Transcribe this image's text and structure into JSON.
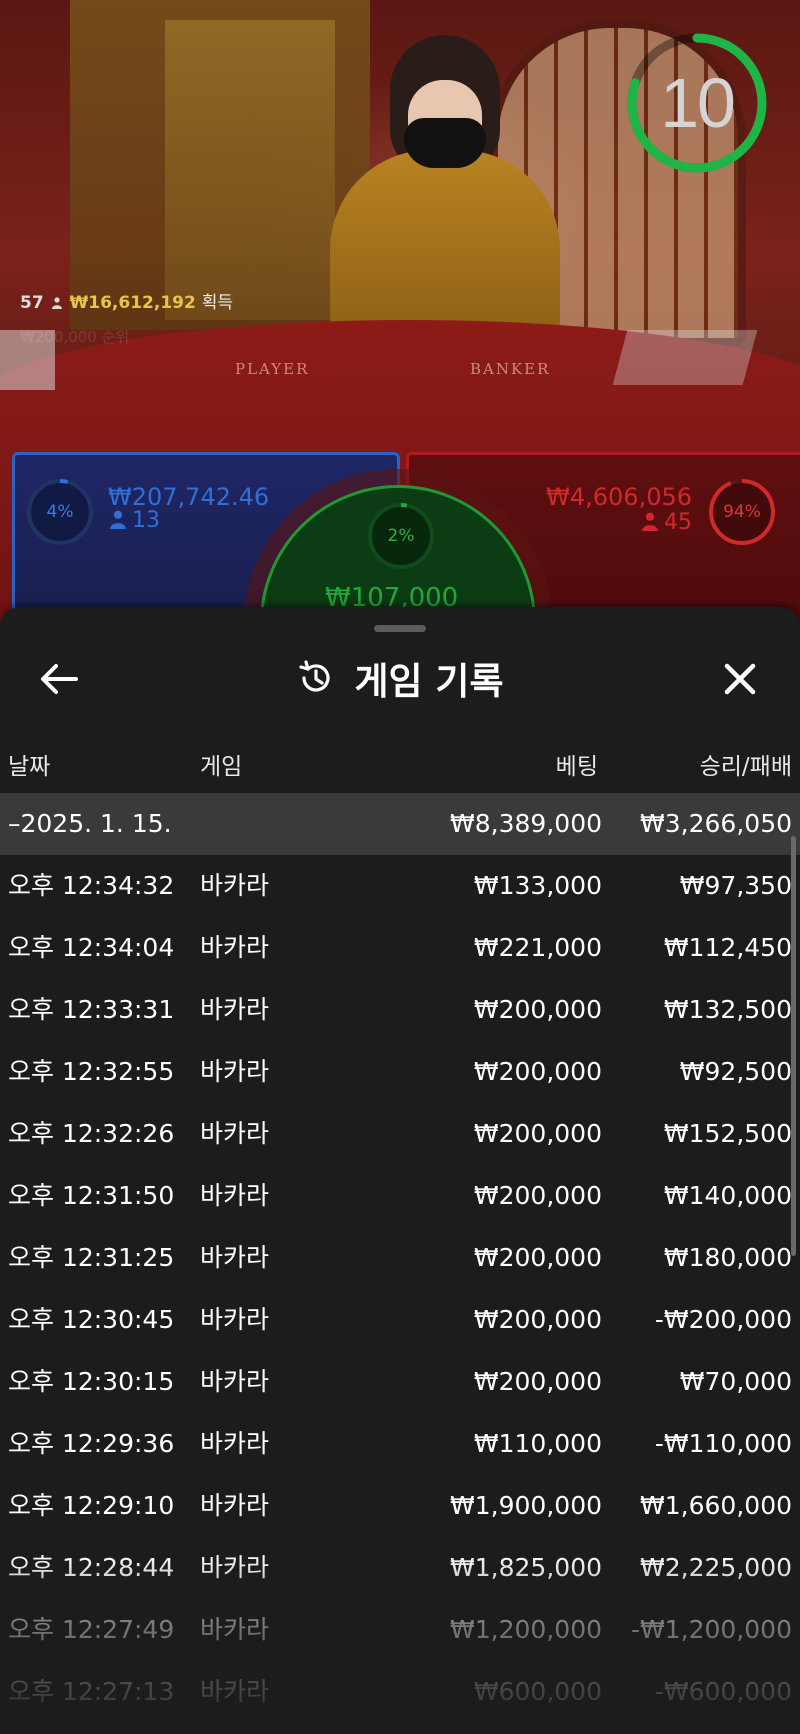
{
  "timer": {
    "value": "10",
    "progress": 0.8,
    "color": "#1fb546"
  },
  "streamer_stats": {
    "count": "57",
    "amount": "₩16,612,192",
    "label": "획득",
    "faded_line": "₩200,000  순위"
  },
  "table_labels": {
    "player": "PLAYER",
    "banker": "BANKER"
  },
  "bets": {
    "player": {
      "percent": "4%",
      "percent_value": 0.04,
      "amount": "₩207,742.46",
      "count": "13",
      "color": "#2f6fd6"
    },
    "banker": {
      "percent": "94%",
      "percent_value": 0.94,
      "amount": "₩4,606,056",
      "count": "45",
      "color": "#d0292a"
    },
    "tie": {
      "percent": "2%",
      "percent_value": 0.02,
      "amount": "₩107,000",
      "color": "#22a83a"
    }
  },
  "history": {
    "title": "게임 기록",
    "columns": {
      "date": "날짜",
      "game": "게임",
      "bet": "베팅",
      "result": "승리/패배"
    },
    "date_group": {
      "label": "–2025. 1. 15.",
      "total_bet": "₩8,389,000",
      "total_result": "₩3,266,050"
    },
    "rows": [
      {
        "time": "오후 12:34:32",
        "game": "바카라",
        "bet": "₩133,000",
        "result": "₩97,350"
      },
      {
        "time": "오후 12:34:04",
        "game": "바카라",
        "bet": "₩221,000",
        "result": "₩112,450"
      },
      {
        "time": "오후 12:33:31",
        "game": "바카라",
        "bet": "₩200,000",
        "result": "₩132,500"
      },
      {
        "time": "오후 12:32:55",
        "game": "바카라",
        "bet": "₩200,000",
        "result": "₩92,500"
      },
      {
        "time": "오후 12:32:26",
        "game": "바카라",
        "bet": "₩200,000",
        "result": "₩152,500"
      },
      {
        "time": "오후 12:31:50",
        "game": "바카라",
        "bet": "₩200,000",
        "result": "₩140,000"
      },
      {
        "time": "오후 12:31:25",
        "game": "바카라",
        "bet": "₩200,000",
        "result": "₩180,000"
      },
      {
        "time": "오후 12:30:45",
        "game": "바카라",
        "bet": "₩200,000",
        "result": "-₩200,000"
      },
      {
        "time": "오후 12:30:15",
        "game": "바카라",
        "bet": "₩200,000",
        "result": "₩70,000"
      },
      {
        "time": "오후 12:29:36",
        "game": "바카라",
        "bet": "₩110,000",
        "result": "-₩110,000"
      },
      {
        "time": "오후 12:29:10",
        "game": "바카라",
        "bet": "₩1,900,000",
        "result": "₩1,660,000"
      },
      {
        "time": "오후 12:28:44",
        "game": "바카라",
        "bet": "₩1,825,000",
        "result": "₩2,225,000"
      },
      {
        "time": "오후 12:27:49",
        "game": "바카라",
        "bet": "₩1,200,000",
        "result": "-₩1,200,000"
      },
      {
        "time": "오후 12:27:13",
        "game": "바카라",
        "bet": "₩600,000",
        "result": "-₩600,000"
      }
    ]
  }
}
